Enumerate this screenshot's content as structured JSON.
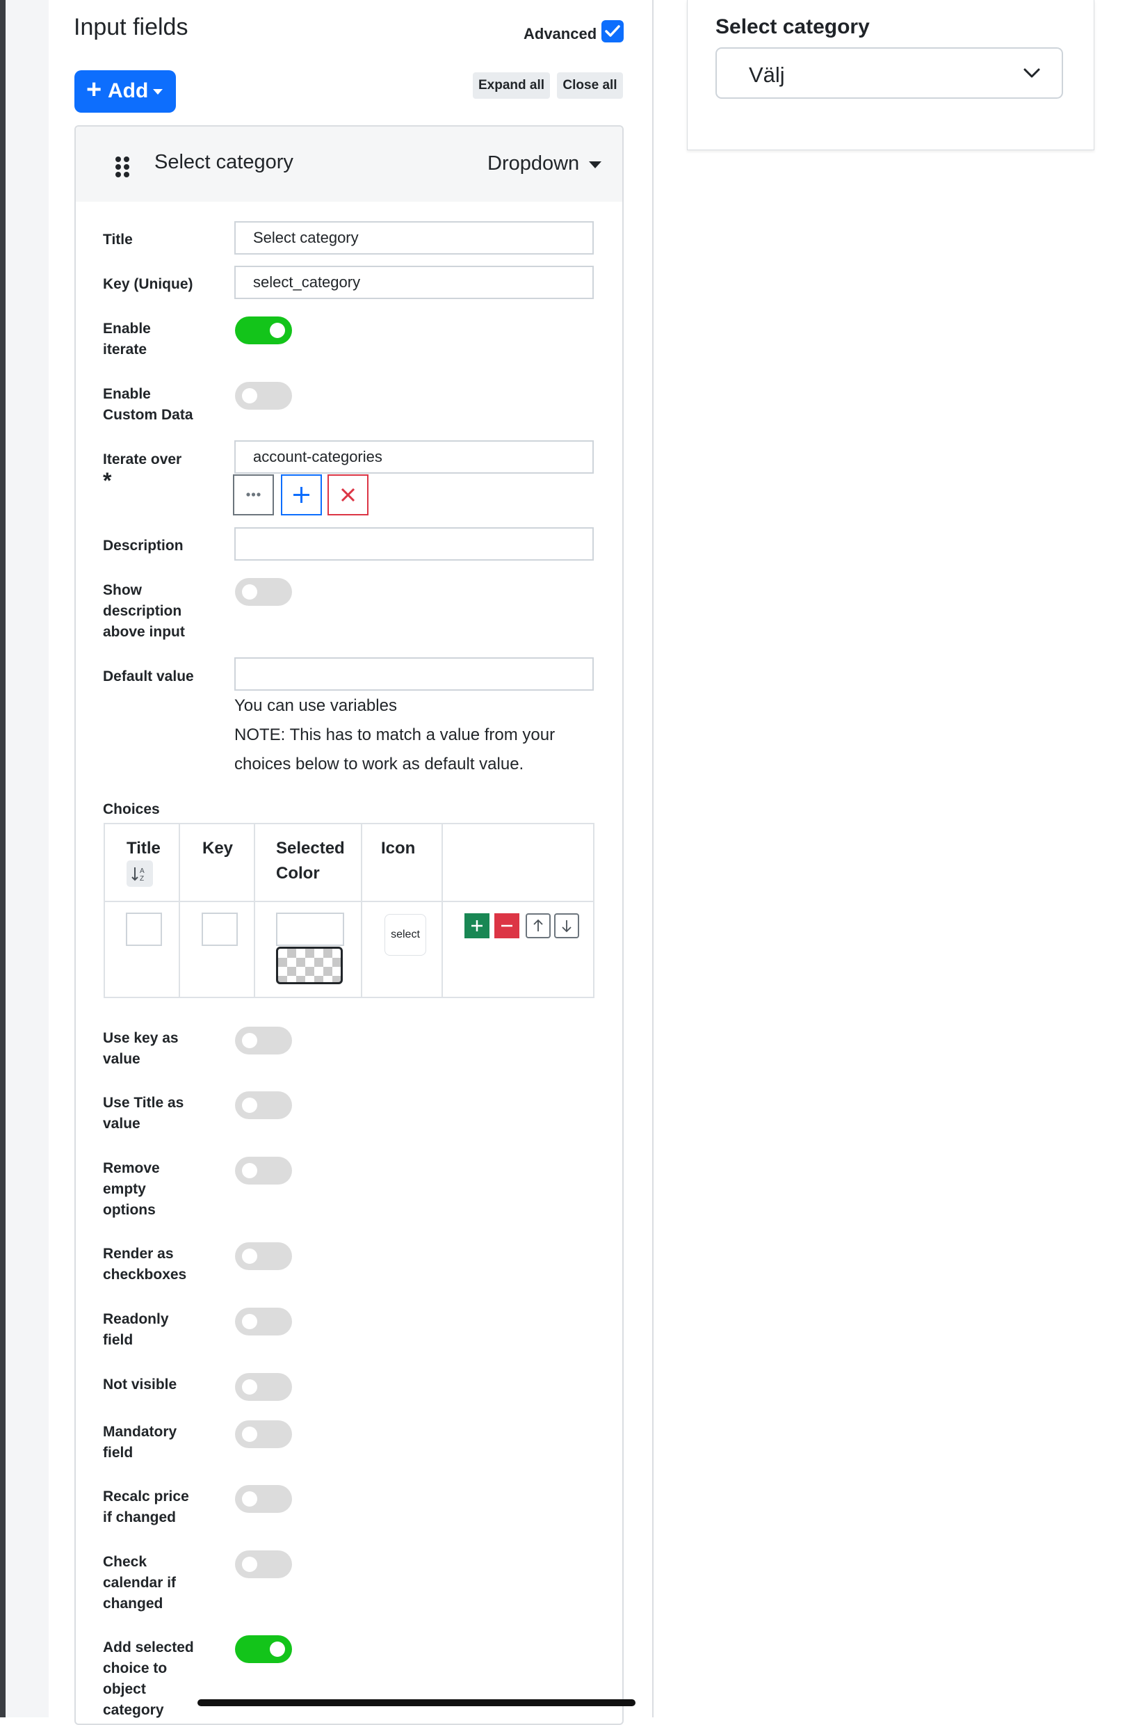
{
  "editor": {
    "section_title": "Input fields",
    "advanced_label": "Advanced",
    "add_label": "Add",
    "expand_all": "Expand all",
    "close_all": "Close all"
  },
  "field": {
    "title": "Select category",
    "type": "Dropdown"
  },
  "form": {
    "title_label": "Title",
    "title_value": "Select category",
    "key_label": "Key (Unique)",
    "key_value": "select_category",
    "enable_iterate_l1": "Enable",
    "enable_iterate_l2": "iterate",
    "enable_custom_l1": "Enable",
    "enable_custom_l2": "Custom Data",
    "iterate_over_label": "Iterate over",
    "required_mark": "*",
    "iterate_over_value": "account-categories",
    "description_label": "Description",
    "description_value": "",
    "show_desc_l1": "Show",
    "show_desc_l2": "description",
    "show_desc_l3": "above input",
    "default_value_label": "Default value",
    "default_value_value": "",
    "help_l1": "You can use variables",
    "help_l2": "NOTE: This has to match a value from your",
    "help_l3": "choices below to work as default value."
  },
  "choices": {
    "label": "Choices",
    "headers": {
      "title": "Title",
      "key": "Key",
      "selected_l1": "Selected",
      "selected_l2": "Color",
      "icon": "Icon"
    },
    "row_icon_text": "select"
  },
  "options": {
    "use_key_l1": "Use key as",
    "use_key_l2": "value",
    "use_title_l1": "Use Title as",
    "use_title_l2": "value",
    "remove_empty_l1": "Remove",
    "remove_empty_l2": "empty",
    "remove_empty_l3": "options",
    "render_cb_l1": "Render as",
    "render_cb_l2": "checkboxes",
    "readonly_l1": "Readonly",
    "readonly_l2": "field",
    "not_visible": "Not visible",
    "mandatory_l1": "Mandatory",
    "mandatory_l2": "field",
    "recalc_l1": "Recalc price",
    "recalc_l2": "if changed",
    "check_cal_l1": "Check",
    "check_cal_l2": "calendar if",
    "check_cal_l3": "changed",
    "add_sel_l1": "Add selected",
    "add_sel_l2": "choice to",
    "add_sel_l3": "object",
    "add_sel_l4": "category"
  },
  "preview": {
    "title": "Select category",
    "select_value": "Välj"
  },
  "colors": {
    "primary": "#0d6efd",
    "toggle_on": "#13c41a",
    "toggle_off": "#dcdcdc",
    "danger": "#dc3545",
    "success": "#198754"
  }
}
